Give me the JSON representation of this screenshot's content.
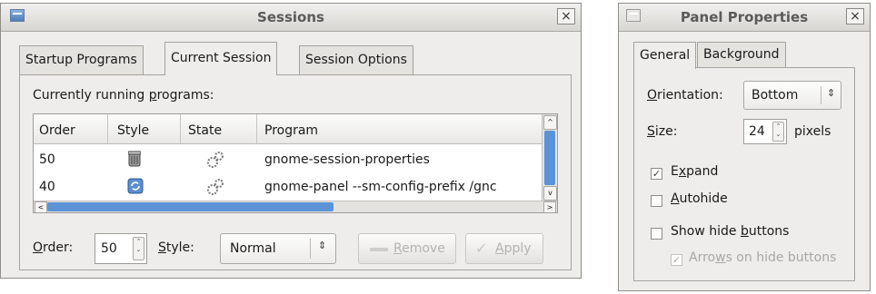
{
  "sessions": {
    "title": "Sessions",
    "close": "×",
    "tabs": [
      "Startup Programs",
      "Current Session",
      "Session Options"
    ],
    "list_label_pre": "Currently running ",
    "list_label_ul": "p",
    "list_label_post": "rograms:",
    "columns": [
      "Order",
      "Style",
      "State",
      "Program"
    ],
    "rows": [
      {
        "order": "50",
        "program": "gnome-session-properties",
        "style_icon": "trash-icon",
        "state_icon": "gears-icon"
      },
      {
        "order": "40",
        "program": "gnome-panel --sm-config-prefix /gnc",
        "style_icon": "refresh-icon",
        "state_icon": "gears-icon"
      }
    ],
    "order_label_ul": "O",
    "order_label_rest": "rder:",
    "order_value": "50",
    "style_label_ul": "S",
    "style_label_rest": "tyle:",
    "style_value": "Normal",
    "remove_label_ul": "R",
    "remove_label_rest": "emove",
    "apply_label_ul": "A",
    "apply_label_rest": "pply"
  },
  "panel": {
    "title": "Panel Properties",
    "close": "×",
    "tabs": [
      "General",
      "Background"
    ],
    "orientation_ul": "O",
    "orientation_rest": "rientation:",
    "orientation_value": "Bottom",
    "size_ul": "S",
    "size_rest": "ize:",
    "size_value": "24",
    "size_unit": "pixels",
    "expand_pre": "E",
    "expand_ul": "x",
    "expand_post": "pand",
    "expand_checked": true,
    "autohide_ul": "A",
    "autohide_rest": "utohide",
    "autohide_checked": false,
    "showhide_pre": "Show hide ",
    "showhide_ul": "b",
    "showhide_post": "uttons",
    "showhide_checked": false,
    "arrows_pre": "Arro",
    "arrows_ul": "w",
    "arrows_post": "s on hide buttons",
    "arrows_checked": true
  },
  "colors": {
    "accent": "#4a86c8",
    "selection": "#5b93d6"
  }
}
